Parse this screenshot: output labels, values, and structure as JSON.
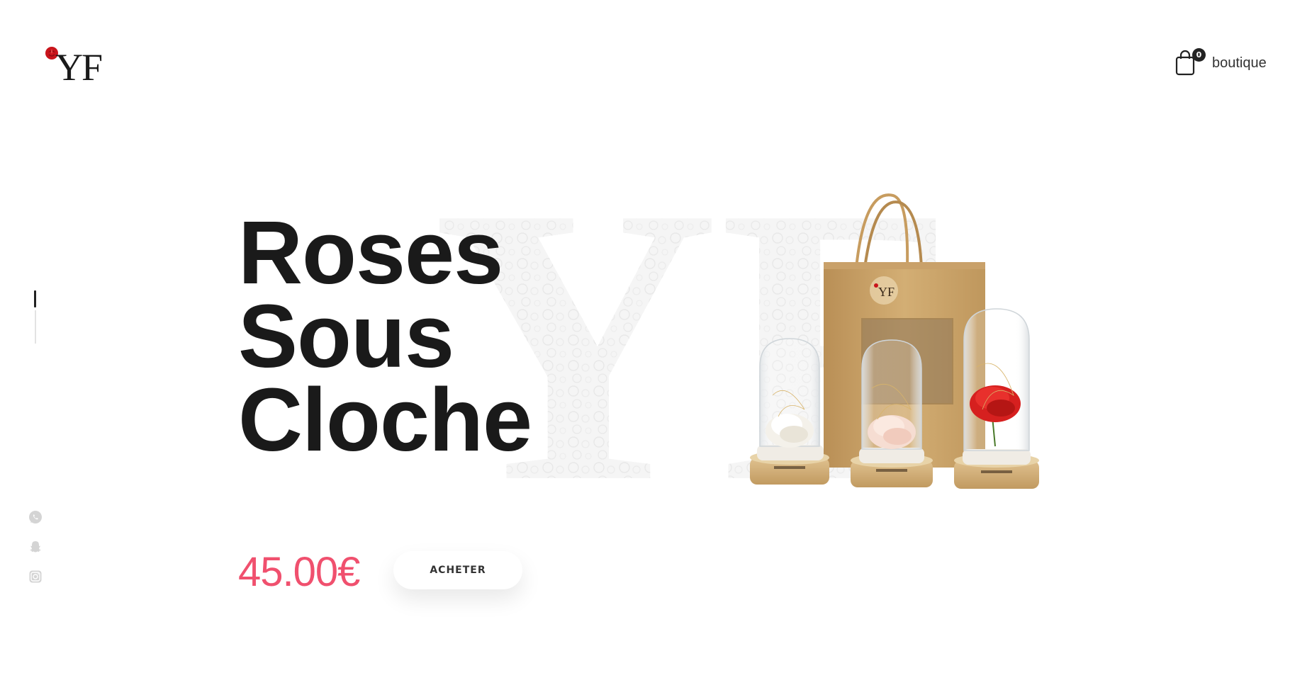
{
  "header": {
    "logo_text": "YF",
    "cart_count": "0",
    "cart_label": "boutique"
  },
  "hero": {
    "title_lines": [
      "Roses",
      "Sous",
      "Cloche"
    ],
    "price": "45.00€",
    "buy_label": "ACHETER",
    "background_letters": "YF"
  },
  "product": {
    "bag_logo": "YF"
  },
  "slider": {
    "active_index": 1,
    "total": 2
  },
  "socials": [
    {
      "icon": "whatsapp-icon"
    },
    {
      "icon": "snapchat-icon"
    },
    {
      "icon": "instagram-icon"
    }
  ],
  "colors": {
    "accent": "#f0506e",
    "text": "#1a1a1a",
    "kraft": "#c8a46e",
    "wood": "#d2b07a",
    "rose_red": "#d6201f",
    "rose_white": "#f4f1ea",
    "rose_pink": "#f6ddd2"
  }
}
